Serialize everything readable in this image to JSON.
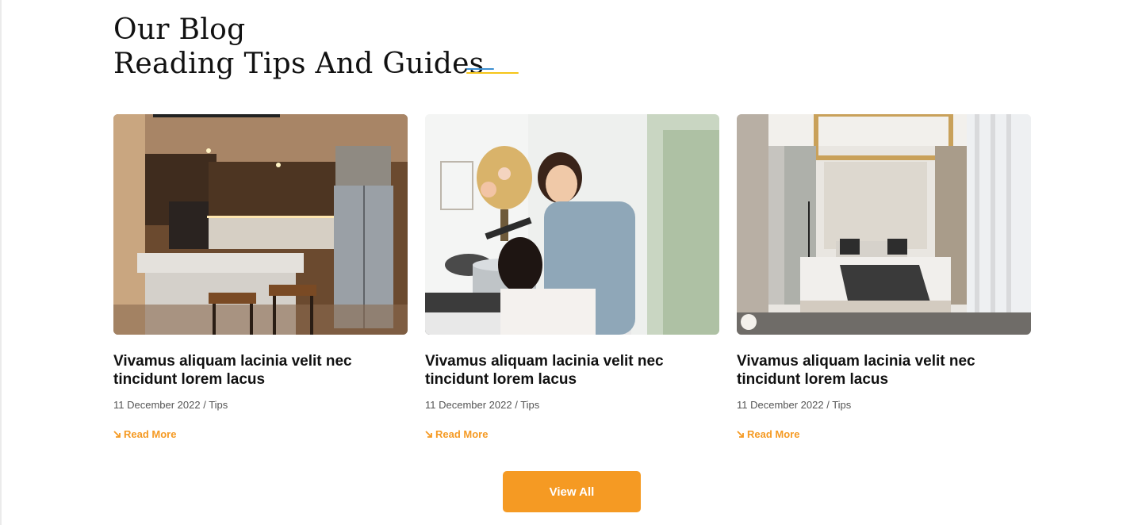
{
  "section": {
    "heading_line1": "Our Blog",
    "heading_line2": "Reading Tips And Guides"
  },
  "colors": {
    "accent_orange": "#f59a23",
    "deco_blue": "#3d8fd1",
    "deco_yellow": "#f5c518",
    "title": "#111111",
    "meta": "#555555"
  },
  "posts": [
    {
      "image_icon": "kitchen-photo",
      "title": "Vivamus aliquam lacinia velit nec tincidunt lorem lacus",
      "meta": "11 December 2022 / Tips",
      "read_more": "Read More"
    },
    {
      "image_icon": "cooking-family-photo",
      "title": "Vivamus aliquam lacinia velit nec tincidunt lorem lacus",
      "meta": "11 December 2022 / Tips",
      "read_more": "Read More"
    },
    {
      "image_icon": "bedroom-photo",
      "title": "Vivamus aliquam lacinia velit nec tincidunt lorem lacus",
      "meta": "11 December 2022 / Tips",
      "read_more": "Read More"
    }
  ],
  "view_all_label": "View All"
}
